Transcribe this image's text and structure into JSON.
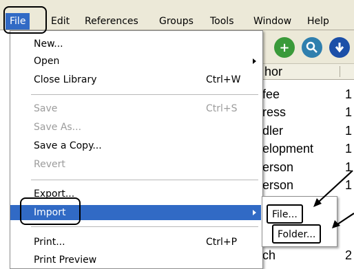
{
  "menubar": {
    "items": [
      {
        "label": "File"
      },
      {
        "label": "Edit"
      },
      {
        "label": "References"
      },
      {
        "label": "Groups"
      },
      {
        "label": "Tools"
      },
      {
        "label": "Window"
      },
      {
        "label": "Help"
      }
    ]
  },
  "toolbar": {
    "icons": [
      "add-icon",
      "search-icon",
      "download-icon"
    ],
    "colors": {
      "add": "#3a9a3a",
      "search": "#2f7fae",
      "download": "#1b4fa8"
    }
  },
  "list": {
    "column_header": "hor",
    "rows": [
      {
        "author": "fee",
        "num": "1"
      },
      {
        "author": "ress",
        "num": "1"
      },
      {
        "author": "dler",
        "num": "1"
      },
      {
        "author": "elopment",
        "num": "1"
      },
      {
        "author": "erson",
        "num": "1"
      },
      {
        "author": "erson",
        "num": "1"
      },
      {
        "author": "ch",
        "num": "2"
      }
    ]
  },
  "file_menu": {
    "new": "New...",
    "open": "Open",
    "close_library": "Close Library",
    "close_library_shortcut": "Ctrl+W",
    "save": "Save",
    "save_shortcut": "Ctrl+S",
    "save_as": "Save As...",
    "save_copy": "Save a Copy...",
    "revert": "Revert",
    "export": "Export...",
    "import": "Import",
    "print": "Print...",
    "print_shortcut": "Ctrl+P",
    "print_preview": "Print Preview"
  },
  "import_submenu": {
    "file": "File...",
    "folder": "Folder..."
  },
  "colors": {
    "highlight": "#316ac5",
    "menubar_bg": "#ece9d8",
    "disabled_text": "#9c9c9c"
  }
}
